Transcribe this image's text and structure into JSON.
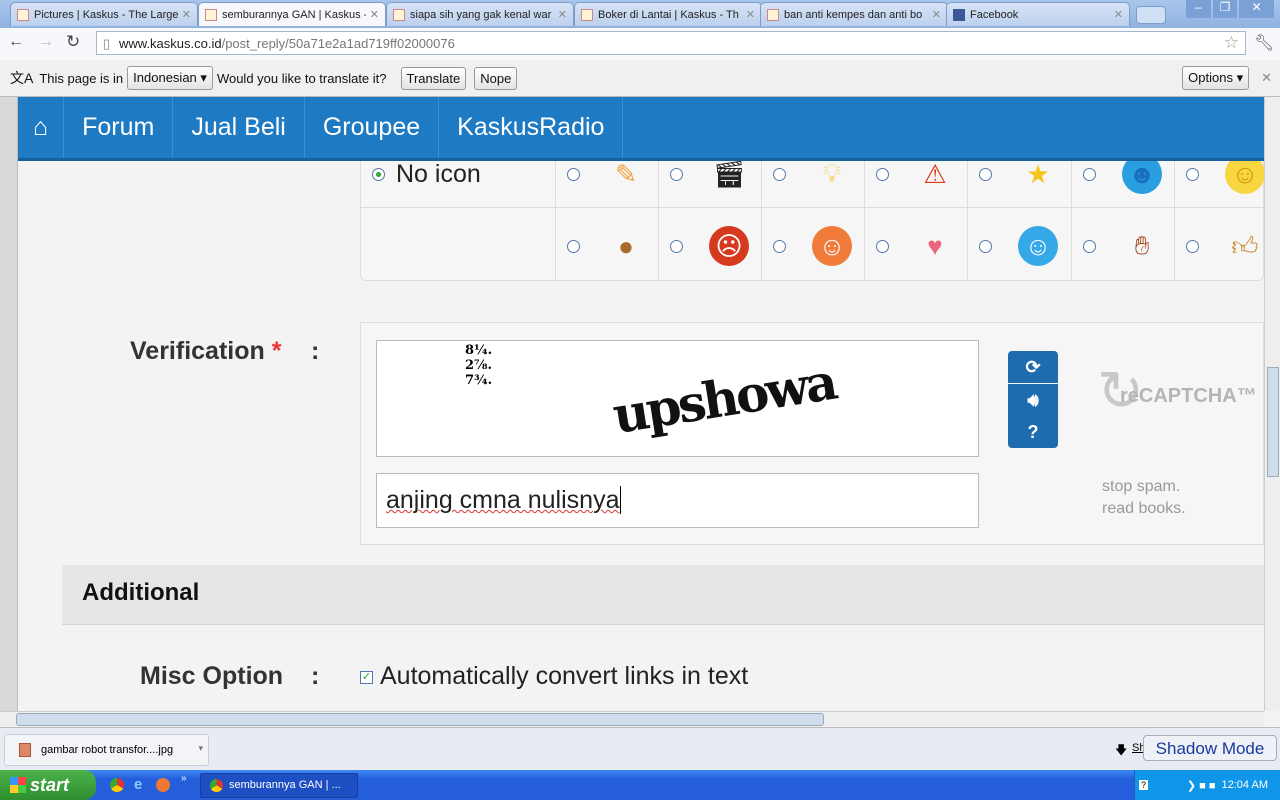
{
  "browser": {
    "tabs": [
      {
        "label": "Pictures | Kaskus - The Large"
      },
      {
        "label": "semburannya GAN | Kaskus -",
        "active": true
      },
      {
        "label": "siapa sih yang gak kenal war"
      },
      {
        "label": "Boker di Lantai | Kaskus - Th"
      },
      {
        "label": "ban anti kempes dan anti bo"
      },
      {
        "label": "Facebook"
      }
    ],
    "url_host": "www.kaskus.co.id",
    "url_path": "/post_reply/50a71e2a1ad719ff02000076"
  },
  "translate_bar": {
    "prefix": "This page is in",
    "language": "Indonesian",
    "question": "Would you like to translate it?",
    "translate": "Translate",
    "nope": "Nope",
    "options": "Options"
  },
  "nav": {
    "items": [
      "Forum",
      "Jual Beli",
      "Groupee",
      "KaskusRadio"
    ]
  },
  "icons": {
    "no_icon_label": "No icon",
    "row1": [
      "pencil",
      "clapper",
      "bulb",
      "warning",
      "star",
      "cool",
      "smile"
    ],
    "row2": [
      "poop",
      "angry",
      "laugh",
      "heart",
      "grin",
      "hand",
      "thumbs-up"
    ]
  },
  "verification": {
    "label": "Verification",
    "required": "*",
    "colon": ":",
    "captcha_word": "upshowa",
    "captcha_fractions": "8¼. 2⅞. 7¾.",
    "input_value": "anjing cmna nulisnya",
    "recaptcha_brand": "reCAPTCHA™",
    "tagline1": "stop spam.",
    "tagline2": "read books."
  },
  "additional": {
    "heading": "Additional"
  },
  "misc": {
    "label": "Misc Option",
    "colon": ":",
    "checkbox_label": "Automatically convert links in text",
    "checked": true
  },
  "downloads": {
    "file": "gambar robot transfor....jpg",
    "show_all": "Sh",
    "shadow_mode": "Shadow Mode"
  },
  "taskbar": {
    "start": "start",
    "window": "semburannya GAN | ...",
    "clock": "12:04 AM"
  }
}
